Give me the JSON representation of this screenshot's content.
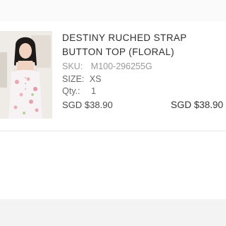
{
  "item": {
    "title": "DESTINY RUCHED STRAP BUTTON TOP (FLORAL)",
    "sku_label": "SKU:",
    "sku_value": "M100-296255G",
    "size_label": "SIZE:",
    "size_value": "XS",
    "qty_label": "Qty.:",
    "qty_value": "1",
    "unit_price": "SGD $38.90",
    "total_price": "SGD $38.90"
  },
  "colors": {
    "accent": "#333333",
    "muted": "#9a9a9a"
  }
}
